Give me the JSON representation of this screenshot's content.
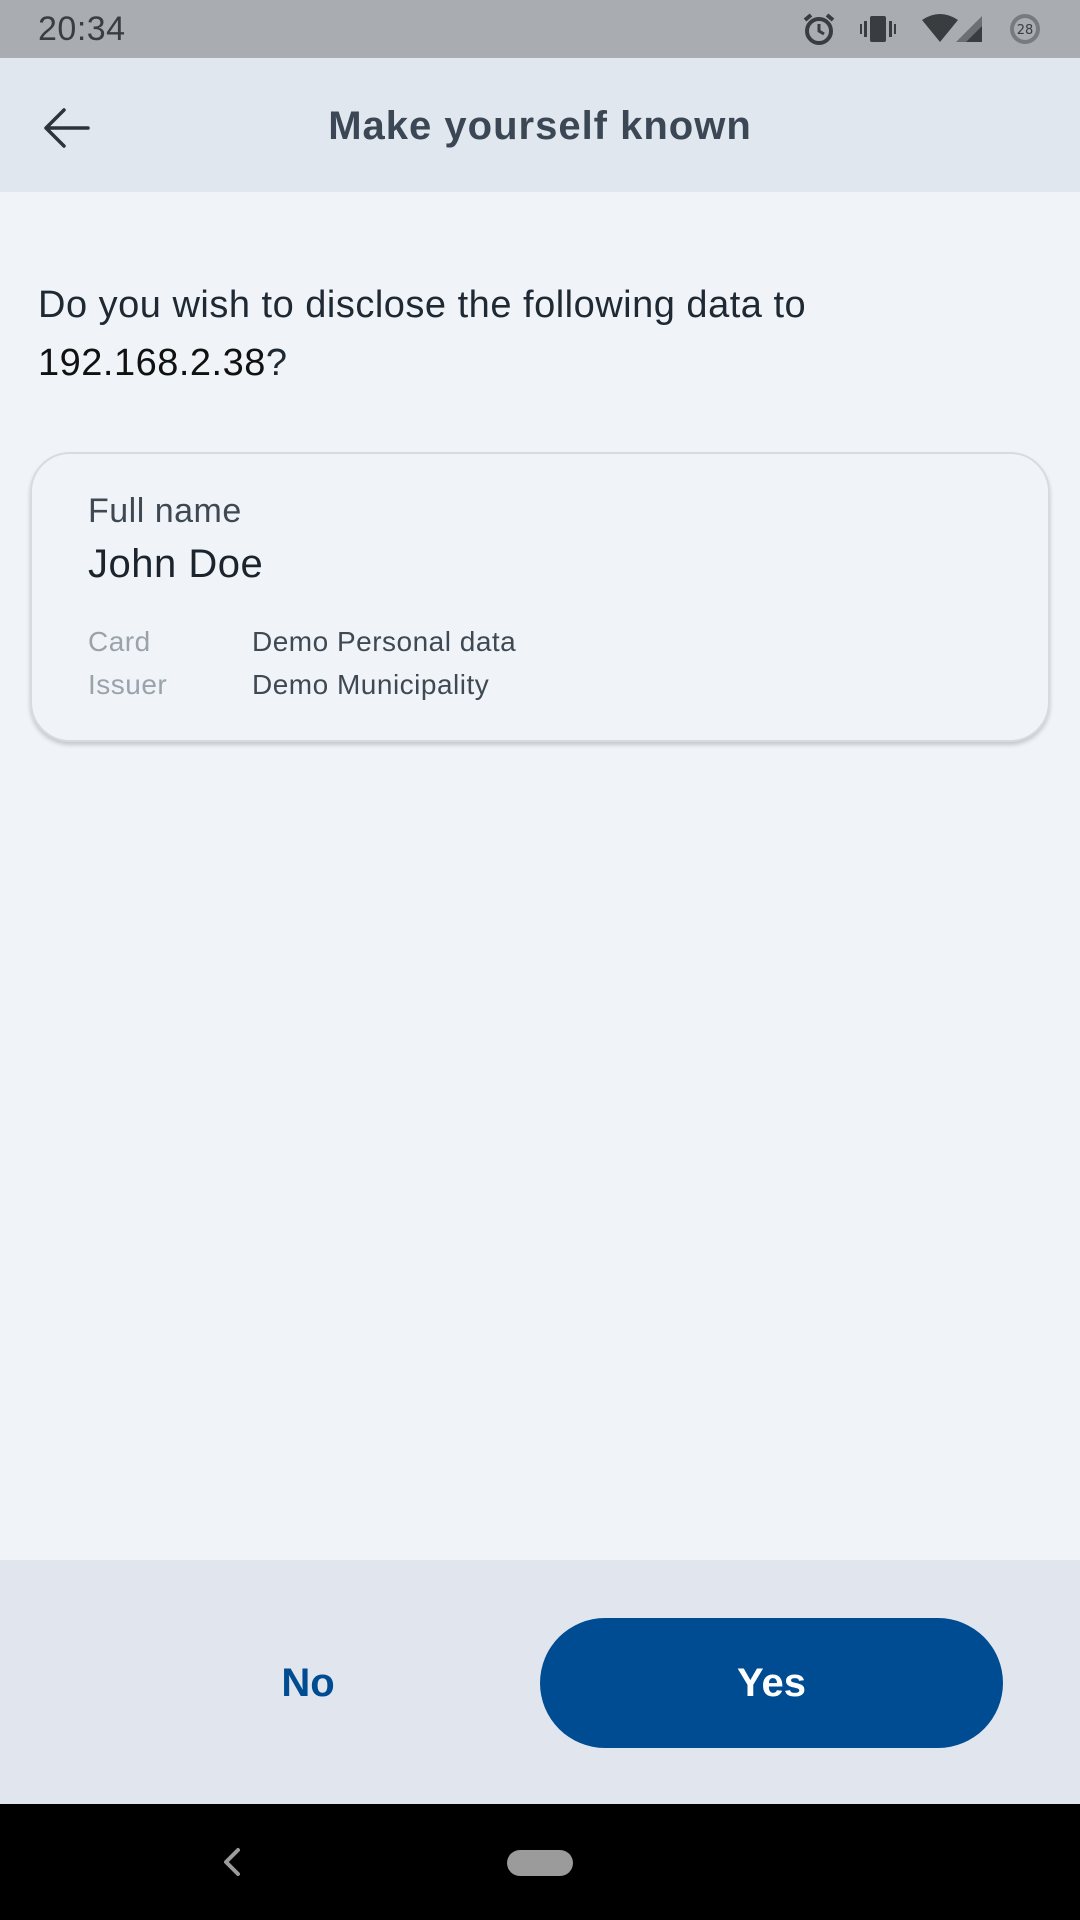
{
  "status_bar": {
    "time": "20:34",
    "battery_level": "28",
    "icons": [
      "alarm-icon",
      "vibrate-icon",
      "wifi-icon",
      "signal-icon",
      "battery-icon"
    ]
  },
  "app_bar": {
    "title": "Make yourself known",
    "back_icon": "arrow-left-icon"
  },
  "question": {
    "prefix": "Do you wish to disclose the following data to",
    "host": "192.168.2.38",
    "suffix": "?"
  },
  "attribute": {
    "label": "Full name",
    "value": "John Doe",
    "card_key": "Card",
    "card_value": "Demo Personal data",
    "issuer_key": "Issuer",
    "issuer_value": "Demo Municipality"
  },
  "actions": {
    "no_label": "No",
    "yes_label": "Yes"
  },
  "colors": {
    "primary": "#004c92",
    "background": "#f0f4f8",
    "bar": "#e1e7ef"
  }
}
